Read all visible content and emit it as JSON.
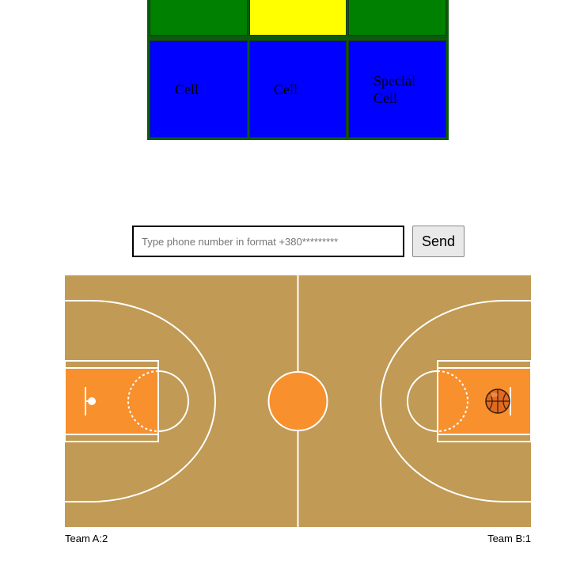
{
  "table": {
    "rows": [
      [
        {
          "text": "",
          "color": "#008000"
        },
        {
          "text": "",
          "color": "#ffff00"
        },
        {
          "text": "",
          "color": "#008000"
        }
      ],
      [
        {
          "text": "Cell",
          "color": "#0000ff"
        },
        {
          "text": "Cell",
          "color": "#0000ff"
        },
        {
          "text": "Special Cell",
          "color": "#0000ff"
        }
      ]
    ],
    "border_color": "#0b5a10"
  },
  "phone_form": {
    "placeholder": "Type phone number in format +380*********",
    "value": "",
    "send_label": "Send"
  },
  "court": {
    "floor_color": "#c19a55",
    "paint_color": "#f7902d",
    "line_color": "#ffffff"
  },
  "scores": {
    "team_a_label": "Team A:",
    "team_a_score": "2",
    "team_b_label": "Team B:",
    "team_b_score": "1"
  }
}
